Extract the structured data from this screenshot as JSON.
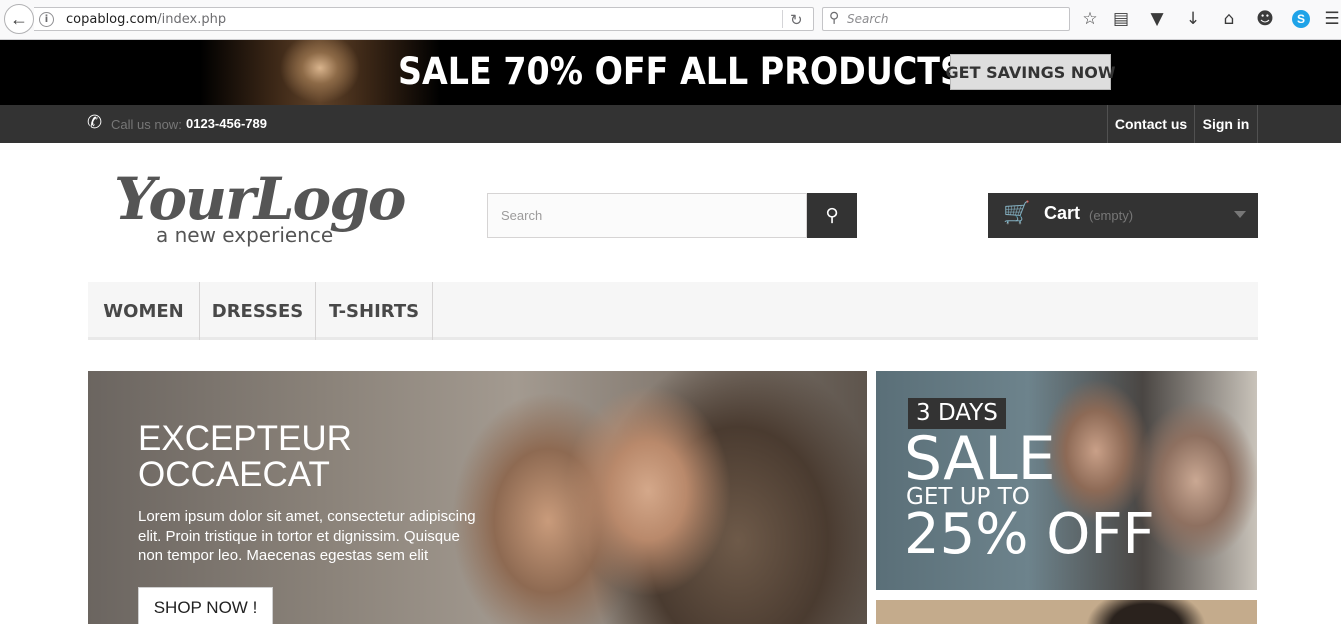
{
  "browser": {
    "url_host": "copablog.com",
    "url_path": "/index.php",
    "search_placeholder": "Search"
  },
  "promo": {
    "text": "SALE 70% OFF ALL PRODUCTS",
    "button": "GET SAVINGS NOW"
  },
  "topbar": {
    "call_label": "Call us now:",
    "phone": "0123-456-789",
    "contact": "Contact us",
    "signin": "Sign in"
  },
  "header": {
    "logo_main": "YourLogo",
    "logo_sub": "a new experience",
    "search_placeholder": "Search",
    "cart_label": "Cart",
    "cart_qty": "(empty)"
  },
  "menu": {
    "items": [
      "WOMEN",
      "DRESSES",
      "T-SHIRTS"
    ]
  },
  "slider": {
    "title_line1": "EXCEPTEUR",
    "title_line2": "OCCAECAT",
    "text": "Lorem ipsum dolor sit amet, consectetur adipiscing elit. Proin tristique in tortor et dignissim. Quisque non tempor leo. Maecenas egestas sem elit",
    "button": "SHOP NOW !"
  },
  "side_banner": {
    "days": "3 DAYS",
    "sale": "SALE",
    "get_up_to": "GET UP TO",
    "off": "25% OFF"
  },
  "colors": {
    "dark": "#333333",
    "menu_bg": "#f6f6f6",
    "promo_bg": "#000000"
  }
}
